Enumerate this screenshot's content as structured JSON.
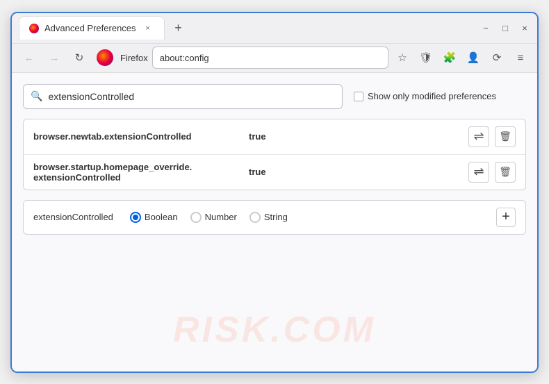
{
  "window": {
    "title": "Advanced Preferences",
    "tab_label": "Advanced Preferences",
    "close_label": "×",
    "minimize_label": "−",
    "maximize_label": "□",
    "new_tab_label": "+"
  },
  "toolbar": {
    "back_label": "←",
    "forward_label": "→",
    "refresh_label": "↻",
    "firefox_label": "Firefox",
    "url": "about:config",
    "bookmark_icon": "☆",
    "shield_icon": "🛡",
    "extensions_icon": "🧩",
    "profile_icon": "👤",
    "sync_icon": "⟳",
    "menu_icon": "≡"
  },
  "search": {
    "value": "extensionControlled",
    "placeholder": "extensionControlled",
    "show_modified_label": "Show only modified preferences"
  },
  "preferences": [
    {
      "name": "browser.newtab.extensionControlled",
      "value": "true"
    },
    {
      "name": "browser.startup.homepage_override.\nextensionControlled",
      "name_line1": "browser.startup.homepage_override.",
      "name_line2": "extensionControlled",
      "value": "true",
      "multiline": true
    }
  ],
  "new_preference": {
    "name": "extensionControlled",
    "type_options": [
      {
        "label": "Boolean",
        "selected": true
      },
      {
        "label": "Number",
        "selected": false
      },
      {
        "label": "String",
        "selected": false
      }
    ],
    "add_label": "+"
  },
  "watermark": "RISK.COM"
}
